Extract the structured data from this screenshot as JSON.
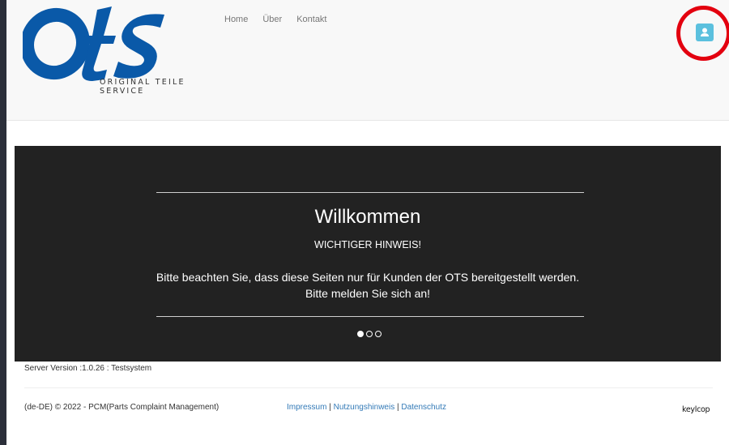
{
  "header": {
    "logo_tagline": "ORIGINAL TEILE SERVICE",
    "nav": [
      {
        "label": "Home"
      },
      {
        "label": "Über"
      },
      {
        "label": "Kontakt"
      }
    ],
    "user_button_icon": "user-icon",
    "highlight_color": "#e3000f",
    "user_button_color": "#5bc0de"
  },
  "carousel": {
    "title": "Willkommen",
    "subtitle": "WICHTIGER HINWEIS!",
    "message": "Bitte beachten Sie, dass diese Seiten nur für Kunden der OTS bereitgestellt werden. Bitte melden Sie sich an!",
    "slide_count": 3,
    "active_slide": 1,
    "background": "#222222"
  },
  "footer": {
    "server_version": "Server Version :1.0.26 : Testsystem",
    "copyright": "(de-DE) © 2022 - PCM(Parts Complaint Management)",
    "links": {
      "impressum": "Impressum",
      "nutzungshinweis": "Nutzungshinweis",
      "datenschutz": "Datenschutz",
      "separator": " | "
    },
    "brand": "keylcop"
  },
  "colors": {
    "logo_blue": "#0a59a8",
    "link_blue": "#337ab7"
  }
}
